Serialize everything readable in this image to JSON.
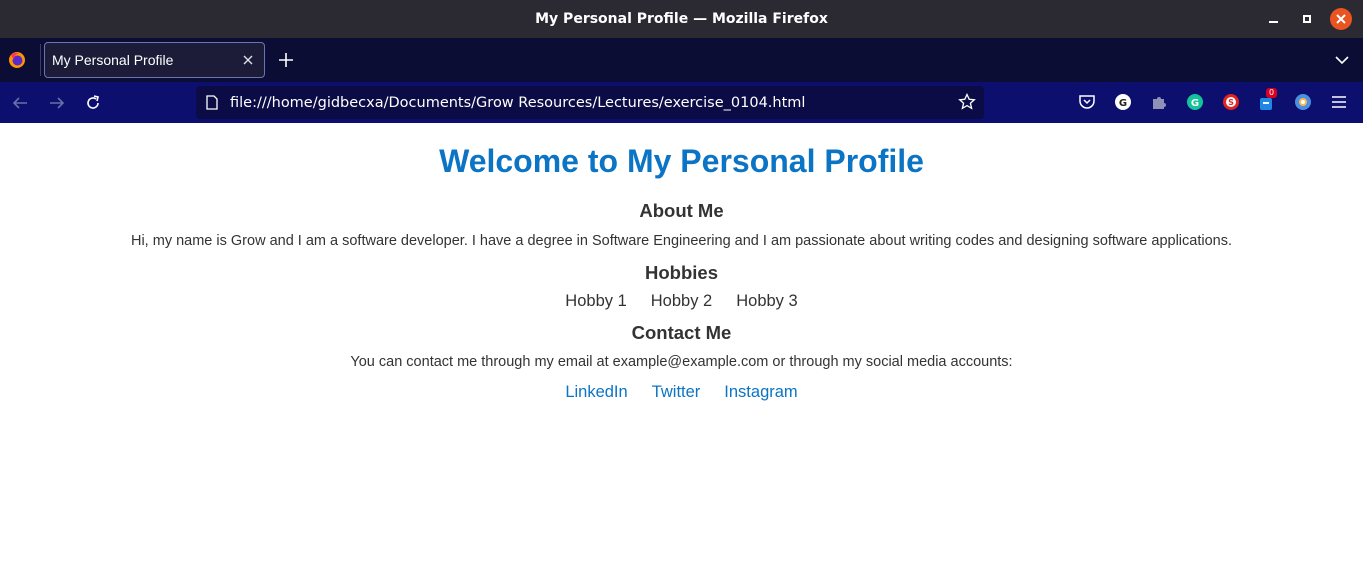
{
  "window": {
    "title": "My Personal Profile — Mozilla Firefox"
  },
  "tabs": [
    {
      "label": "My Personal Profile"
    }
  ],
  "navbar": {
    "url": "file:///home/gidbecxa/Documents/Grow Resources/Lectures/exercise_0104.html",
    "extension_badge": "0"
  },
  "page": {
    "title": "Welcome to My Personal Profile",
    "about": {
      "heading": "About Me",
      "text": "Hi, my name is Grow and I am a software developer. I have a degree in Software Engineering and I am passionate about writing codes and designing software applications."
    },
    "hobbies": {
      "heading": "Hobbies",
      "items": [
        "Hobby 1",
        "Hobby 2",
        "Hobby 3"
      ]
    },
    "contact": {
      "heading": "Contact Me",
      "text": "You can contact me through my email at example@example.com or through my social media accounts:",
      "links": [
        "LinkedIn",
        "Twitter",
        "Instagram"
      ]
    }
  },
  "colors": {
    "accent": "#0b74c4",
    "titlebar": "#2b2a33",
    "tabbar": "#0b0d34",
    "navbar": "#0d0f6e",
    "close": "#e95420"
  }
}
